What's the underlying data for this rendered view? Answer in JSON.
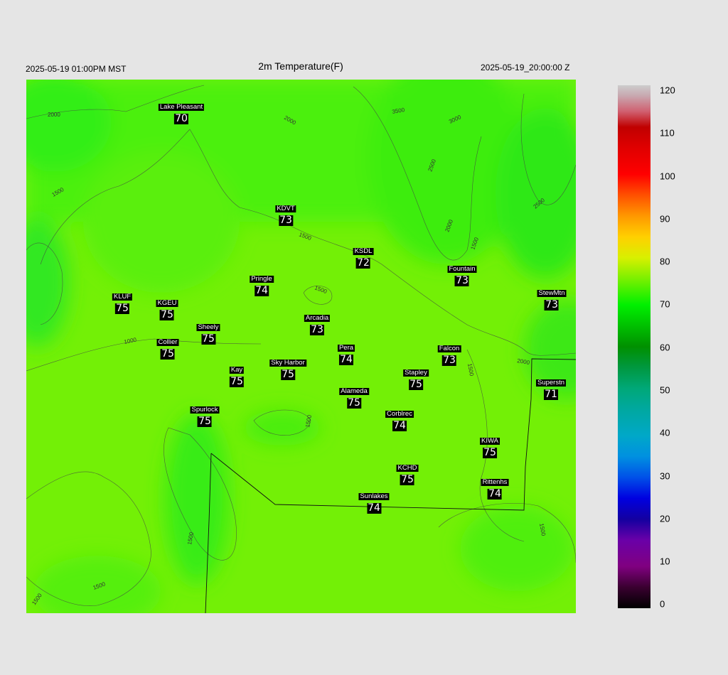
{
  "header": {
    "local_time": "2025-05-19 01:00PM MST",
    "title": "2m Temperature(F)",
    "utc_time": "2025-05-19_20:00:00 Z"
  },
  "colorbar": {
    "ticks": [
      "0",
      "10",
      "20",
      "30",
      "40",
      "50",
      "60",
      "70",
      "80",
      "90",
      "100",
      "110",
      "120"
    ],
    "range": [
      0,
      120
    ]
  },
  "contour_labels": [
    "2000",
    "1500",
    "1000",
    "1500",
    "1500",
    "1500",
    "1500",
    "1500",
    "2000",
    "2500",
    "3000",
    "3500",
    "2000",
    "2500",
    "1500",
    "2000",
    "1500",
    "1500",
    "1500"
  ],
  "stations": [
    {
      "name": "Lake Pleasant",
      "temp": "70"
    },
    {
      "name": "KDVT",
      "temp": "73"
    },
    {
      "name": "KSDL",
      "temp": "72"
    },
    {
      "name": "Fountain",
      "temp": "73"
    },
    {
      "name": "Pringle",
      "temp": "74"
    },
    {
      "name": "StewMtn",
      "temp": "73"
    },
    {
      "name": "KLUF",
      "temp": "75"
    },
    {
      "name": "KGEU",
      "temp": "75"
    },
    {
      "name": "Arcadia",
      "temp": "73"
    },
    {
      "name": "Sheely",
      "temp": "75"
    },
    {
      "name": "Collier",
      "temp": "75"
    },
    {
      "name": "Pera",
      "temp": "74"
    },
    {
      "name": "Falcon",
      "temp": "73"
    },
    {
      "name": "Kay",
      "temp": "75"
    },
    {
      "name": "Sky Harbor",
      "temp": "75"
    },
    {
      "name": "Stapley",
      "temp": "75"
    },
    {
      "name": "Superstn",
      "temp": "71"
    },
    {
      "name": "Alameda",
      "temp": "75"
    },
    {
      "name": "Spurlock",
      "temp": "75"
    },
    {
      "name": "Corblrec",
      "temp": "74"
    },
    {
      "name": "KIWA",
      "temp": "75"
    },
    {
      "name": "KCHD",
      "temp": "75"
    },
    {
      "name": "Rittenhs",
      "temp": "74"
    },
    {
      "name": "Sunlakes",
      "temp": "74"
    }
  ]
}
